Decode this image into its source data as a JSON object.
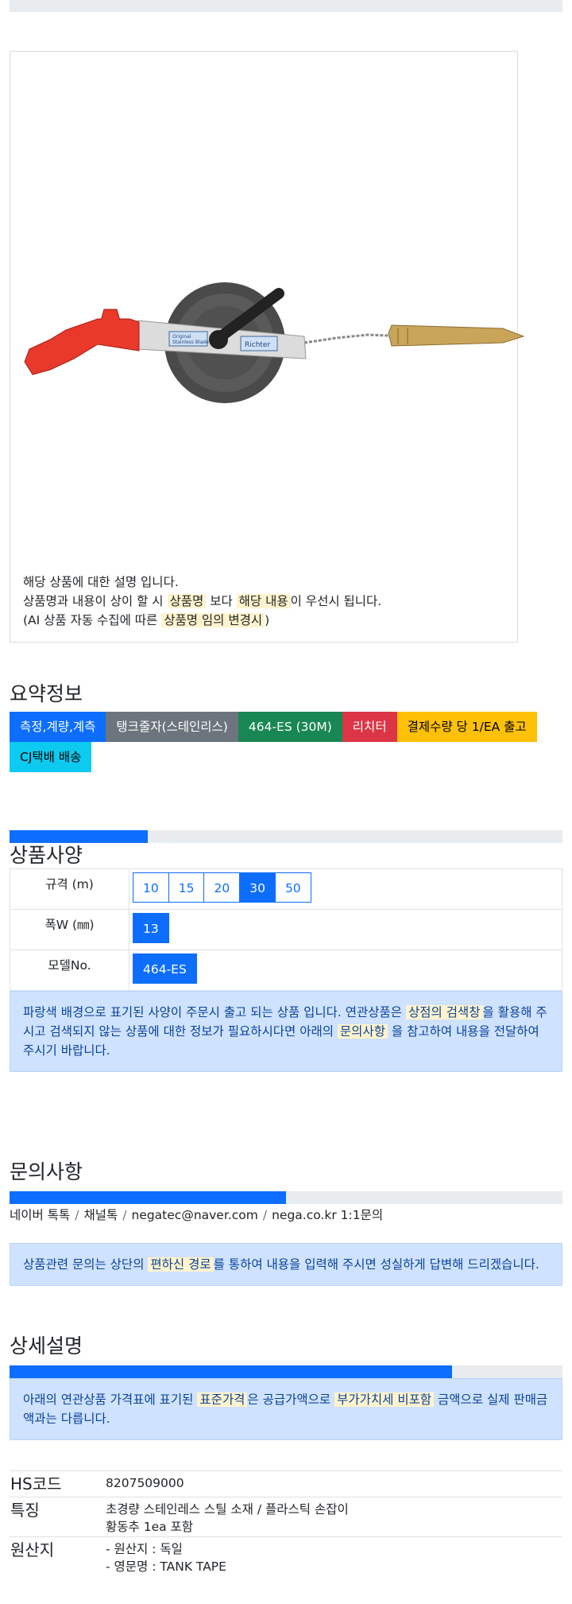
{
  "product": {
    "description_lines": [
      [
        "해당 상품에 대한 설명 입니다."
      ],
      [
        "상품명과 내용이 상이 할 시 ",
        "상품명",
        " 보다 ",
        "해당 내용",
        "이 우선시 됩니다."
      ],
      [
        "(AI 상품 자동 수집에 따른 ",
        "상품명 임의 변경시",
        ")"
      ]
    ],
    "image_labels": {
      "brand": "Richter",
      "label_line1": "Original",
      "label_line2": "Richter",
      "label_line3": "Stainless Blade"
    }
  },
  "summary": {
    "title": "요약정보",
    "badges": [
      {
        "label": "측정,계량,계측",
        "color": "#0d6efd",
        "text_color": "#ffffff"
      },
      {
        "label": "탱크줄자(스테인리스)",
        "color": "#6c757d",
        "text_color": "#ffffff"
      },
      {
        "label": "464-ES (30M)",
        "color": "#198754",
        "text_color": "#ffffff"
      },
      {
        "label": "리치터",
        "color": "#dc3545",
        "text_color": "#ffffff"
      },
      {
        "label": "결제수량 당 1/EA 출고",
        "color": "#ffc107",
        "text_color": "#000000"
      },
      {
        "label": "CJ택배 배송",
        "color": "#0dcaf0",
        "text_color": "#000000"
      }
    ]
  },
  "spec": {
    "title": "상품사양",
    "progress": 0.25,
    "rows": [
      {
        "label": "규격 (m)",
        "options": [
          "10",
          "15",
          "20",
          "30",
          "50"
        ],
        "selected": "30"
      },
      {
        "label": "폭W (㎜)",
        "options": [
          "13"
        ],
        "selected": "13"
      },
      {
        "label": "모델No.",
        "options": [
          "464-ES"
        ],
        "selected": "464-ES"
      }
    ],
    "notice": [
      "파랑색 배경으로 표기된 사양이 주문시 출고 되는 상품 입니다. 연관상품은 ",
      "상점의 검색창",
      "을 활용해 주시고 검색되지 않는 상품에 대한 정보가 필요하시다면 아래의 ",
      "문의사항",
      " 을 참고하여 내용을 전달하여 주시기 바랍니다."
    ]
  },
  "inquiry": {
    "title": "문의사항",
    "progress": 0.5,
    "contacts": [
      "네이버 톡톡",
      "채널톡",
      "negatec@naver.com",
      "nega.co.kr 1:1문의"
    ],
    "notice": [
      "상품관련 문의는 상단의 ",
      "편하신 경로",
      "를 통하여 내용을 입력해 주시면 성실하게 답변해 드리겠습니다."
    ]
  },
  "detail": {
    "title": "상세설명",
    "progress": 0.8,
    "notice": [
      "아래의 연관상품 가격표에 표기된 ",
      "표준가격",
      "은 공급가액으로 ",
      "부가가치세 비포함",
      " 금액으로 실제 판매금액과는 다릅니다."
    ],
    "info": [
      {
        "key": "HS코드",
        "values": [
          "8207509000"
        ]
      },
      {
        "key": "특징",
        "values": [
          "초경량 스테인레스 스틸 소재 / 플라스틱 손잡이",
          "황동추 1ea 포함"
        ]
      },
      {
        "key": "원산지",
        "values": [
          "- 원산지 : 독일",
          "- 영문명 : TANK TAPE"
        ]
      }
    ]
  }
}
